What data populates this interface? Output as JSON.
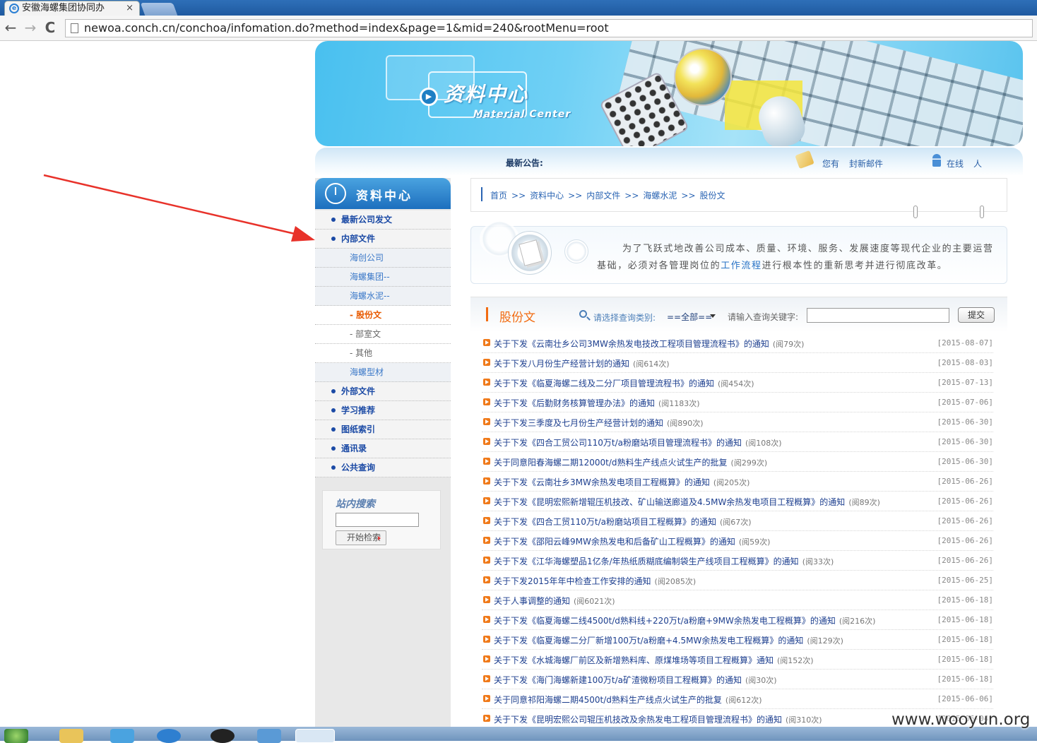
{
  "browser": {
    "tab_title": "安徽海螺集团协同办",
    "tab_close": "×",
    "url": "newoa.conch.cn/conchoa/infomation.do?method=index&page=1&mid=240&rootMenu=root",
    "back": "←",
    "forward": "→",
    "reload": "C"
  },
  "banner": {
    "title": "资料中心",
    "subtitle": "Material Center"
  },
  "noticebar": {
    "notice_label": "最新公告:",
    "mail_prefix": "您有",
    "mail_text": "封新邮件",
    "online_label": "在线",
    "online_unit": "人"
  },
  "sidebar": {
    "title": "资料中心",
    "items": [
      {
        "label": "最新公司发文",
        "level": 1
      },
      {
        "label": "内部文件",
        "level": 1
      },
      {
        "label": "海创公司",
        "level": 2
      },
      {
        "label": "海螺集团--",
        "level": 2
      },
      {
        "label": "海螺水泥--",
        "level": 2
      },
      {
        "label": "- 股份文",
        "level": 3,
        "active": true
      },
      {
        "label": "- 部室文",
        "level": 3
      },
      {
        "label": "- 其他",
        "level": 3
      },
      {
        "label": "海螺型材",
        "level": 2
      },
      {
        "label": "外部文件",
        "level": 1
      },
      {
        "label": "学习推荐",
        "level": 1
      },
      {
        "label": "图纸索引",
        "level": 1
      },
      {
        "label": "通讯录",
        "level": 1
      },
      {
        "label": "公共查询",
        "level": 1
      }
    ],
    "search": {
      "title": "站内搜索",
      "input_value": "",
      "button": "开始检索"
    }
  },
  "breadcrumb": [
    "首页",
    "资料中心",
    "内部文件",
    "海螺水泥",
    "股份文"
  ],
  "breadcrumb_sep": ">>",
  "intro": {
    "before_link": "为了飞跃式地改善公司成本、质量、环境、服务、发展速度等现代企业的主要运营基础，必须对各管理岗位的",
    "link": "工作流程",
    "after_link": "进行根本性的重新思考并进行彻底改革。"
  },
  "list": {
    "title": "股份文",
    "category_label": "请选择查询类别:",
    "category_value": "==全部==",
    "keyword_label": "请输入查询关键字:",
    "keyword_value": "",
    "submit": "提交",
    "rows": [
      {
        "title": "关于下发《云南壮乡公司3MW余热发电技改工程项目管理流程书》的通知",
        "views": "(阅79次)",
        "date": "[2015-08-07]"
      },
      {
        "title": "关于下发八月份生产经营计划的通知",
        "views": "(阅614次)",
        "date": "[2015-08-03]"
      },
      {
        "title": "关于下发《临夏海螺二线及二分厂项目管理流程书》的通知",
        "views": "(阅454次)",
        "date": "[2015-07-13]"
      },
      {
        "title": "关于下发《后勤财务核算管理办法》的通知",
        "views": "(阅1183次)",
        "date": "[2015-07-06]"
      },
      {
        "title": "关于下发三季度及七月份生产经营计划的通知",
        "views": "(阅890次)",
        "date": "[2015-06-30]"
      },
      {
        "title": "关于下发《四合工贸公司110万t/a粉磨站项目管理流程书》的通知",
        "views": "(阅108次)",
        "date": "[2015-06-30]"
      },
      {
        "title": "关于同意阳春海螺二期12000t/d熟料生产线点火试生产的批复",
        "views": "(阅299次)",
        "date": "[2015-06-30]"
      },
      {
        "title": "关于下发《云南壮乡3MW余热发电项目工程概算》的通知",
        "views": "(阅205次)",
        "date": "[2015-06-26]"
      },
      {
        "title": "关于下发《昆明宏熙新增辊压机技改、矿山输送廊道及4.5MW余热发电项目工程概算》的通知",
        "views": "(阅89次)",
        "date": "[2015-06-26]"
      },
      {
        "title": "关于下发《四合工贸110万t/a粉磨站项目工程概算》的通知",
        "views": "(阅67次)",
        "date": "[2015-06-26]"
      },
      {
        "title": "关于下发《邵阳云峰9MW余热发电和后备矿山工程概算》的通知",
        "views": "(阅59次)",
        "date": "[2015-06-26]"
      },
      {
        "title": "关于下发《江华海螺塑品1亿条/年热纸质糊底编制袋生产线项目工程概算》的通知",
        "views": "(阅33次)",
        "date": "[2015-06-26]"
      },
      {
        "title": "关于下发2015年年中检查工作安排的通知",
        "views": "(阅2085次)",
        "date": "[2015-06-25]"
      },
      {
        "title": "关于人事调整的通知",
        "views": "(阅6021次)",
        "date": "[2015-06-18]"
      },
      {
        "title": "关于下发《临夏海螺二线4500t/d熟料线+220万t/a粉磨+9MW余热发电工程概算》的通知",
        "views": "(阅216次)",
        "date": "[2015-06-18]"
      },
      {
        "title": "关于下发《临夏海螺二分厂新增100万t/a粉磨+4.5MW余热发电工程概算》的通知",
        "views": "(阅129次)",
        "date": "[2015-06-18]"
      },
      {
        "title": "关于下发《水城海螺厂前区及新增熟料库、原煤堆场等项目工程概算》通知",
        "views": "(阅152次)",
        "date": "[2015-06-18]"
      },
      {
        "title": "关于下发《海门海螺新建100万t/a矿渣微粉项目工程概算》的通知",
        "views": "(阅30次)",
        "date": "[2015-06-18]"
      },
      {
        "title": "关于同意祁阳海螺二期4500t/d熟料生产线点火试生产的批复",
        "views": "(阅612次)",
        "date": "[2015-06-06]"
      },
      {
        "title": "关于下发《昆明宏熙公司辊压机技改及余热发电工程项目管理流程书》的通知",
        "views": "(阅310次)",
        "date": "[2015-06-04]"
      }
    ]
  },
  "watermark": "www.wooyun.org",
  "colors": {
    "accent_blue": "#1d6fbe",
    "accent_orange": "#f26c12",
    "annotation_arrow": "#e8322a"
  }
}
